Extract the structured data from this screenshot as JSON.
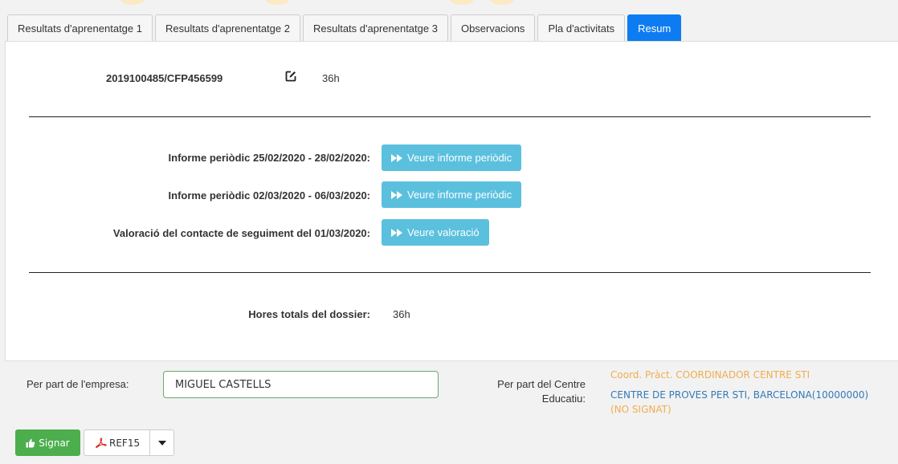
{
  "tabs": [
    {
      "label": "Resultats d'aprenentatge 1"
    },
    {
      "label": "Resultats d'aprenentatge 2"
    },
    {
      "label": "Resultats d'aprenentatge 3"
    },
    {
      "label": "Observacions"
    },
    {
      "label": "Pla d'activitats"
    },
    {
      "label": "Resum",
      "active": true
    }
  ],
  "summary": {
    "code": "2019100485/CFP456599",
    "hours": "36h",
    "rows": [
      {
        "label": "Informe periòdic 25/02/2020 - 28/02/2020:",
        "button": "Veure informe periòdic"
      },
      {
        "label": "Informe periòdic 02/03/2020 - 06/03/2020:",
        "button": "Veure informe periòdic"
      },
      {
        "label": "Valoració del contacte de seguiment del 01/03/2020:",
        "button": "Veure valoració"
      }
    ],
    "total_label": "Hores totals del dossier:",
    "total_value": "36h"
  },
  "signatures": {
    "company_label": "Per part de l'empresa:",
    "company_value": "MIGUEL CASTELLS",
    "centre_label_line1": "Per part del Centre",
    "centre_label_line2": "Educatiu:",
    "coord_line": "Coord. Pràct. COORDINADOR CENTRE STI",
    "centre_line": "CENTRE DE PROVES PER STI, BARCELONA(10000000)",
    "status_line": "(NO SIGNAT)"
  },
  "actions": {
    "sign_label": "Signar",
    "ref_label": "REF15"
  },
  "colors": {
    "active_tab": "#0d7cf2",
    "info_button": "#5bc0de",
    "sign_button": "#4cae4c",
    "coord_text": "#f0ad4e",
    "centre_text": "#337ab7"
  },
  "icons": {
    "edit": "edit-icon",
    "forward": "fast-forward-icon",
    "sign": "thumbs-up-icon",
    "pdf": "pdf-icon",
    "dropdown": "caret-down-icon"
  }
}
